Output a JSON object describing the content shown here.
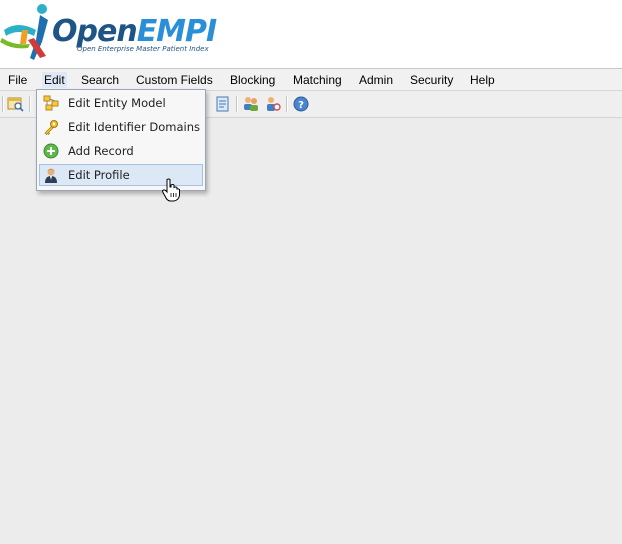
{
  "app": {
    "logo_text_open": "Open",
    "logo_text_empi": "EMPI",
    "logo_tagline": "Open Enterprise Master Patient Index"
  },
  "menubar": {
    "items": [
      {
        "label": "File"
      },
      {
        "label": "Edit"
      },
      {
        "label": "Search"
      },
      {
        "label": "Custom Fields"
      },
      {
        "label": "Blocking"
      },
      {
        "label": "Matching"
      },
      {
        "label": "Admin"
      },
      {
        "label": "Security"
      },
      {
        "label": "Help"
      }
    ],
    "active": "Edit"
  },
  "toolbar": {
    "buttons": [
      {
        "icon": "search-window-icon"
      },
      {
        "icon": "document-icon"
      },
      {
        "icon": "users-icon"
      },
      {
        "icon": "user-link-icon"
      },
      {
        "icon": "help-icon"
      }
    ]
  },
  "edit_menu": {
    "items": [
      {
        "label": "Edit Entity Model",
        "icon": "entity-model-icon"
      },
      {
        "label": "Edit Identifier Domains",
        "icon": "key-icon"
      },
      {
        "label": "Add Record",
        "icon": "add-icon"
      },
      {
        "label": "Edit Profile",
        "icon": "profile-user-icon"
      }
    ],
    "hovered": "Edit Profile"
  },
  "colors": {
    "brand_dark": "#1f5487",
    "brand_light": "#2a8fd6",
    "menu_hover_bg": "#dde8f6",
    "menu_hover_border": "#a9c1e0",
    "workspace_bg": "#ececec"
  }
}
